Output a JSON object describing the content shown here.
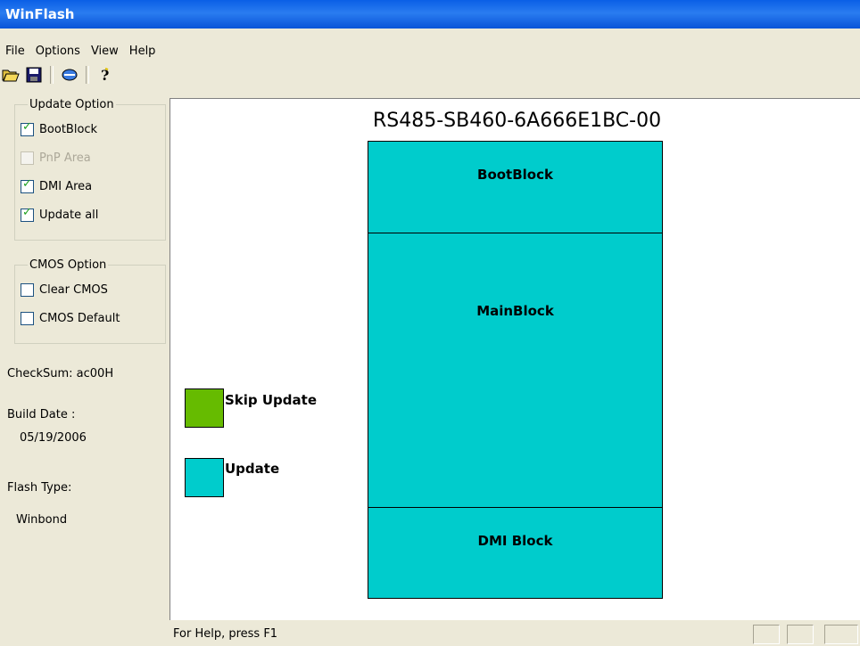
{
  "window": {
    "title": "WinFlash"
  },
  "menu": [
    "File",
    "Options",
    "View",
    "Help"
  ],
  "toolbar": {
    "icons": [
      "open-folder-icon",
      "save-icon",
      "flash-icon",
      "help-icon"
    ]
  },
  "update_option": {
    "legend": "Update Option",
    "items": [
      {
        "label": "BootBlock",
        "checked": true,
        "enabled": true
      },
      {
        "label": "PnP Area",
        "checked": false,
        "enabled": false
      },
      {
        "label": "DMI Area",
        "checked": true,
        "enabled": true
      },
      {
        "label": "Update all",
        "checked": true,
        "enabled": true
      }
    ]
  },
  "cmos_option": {
    "legend": "CMOS Option",
    "items": [
      {
        "label": "Clear CMOS",
        "checked": false,
        "enabled": true
      },
      {
        "label": "CMOS Default",
        "checked": false,
        "enabled": true
      }
    ]
  },
  "info": {
    "checksum_label": "CheckSum:",
    "checksum_value": "ac00H",
    "build_date_label": "Build Date :",
    "build_date_value": "05/19/2006",
    "flash_type_label": "Flash Type:",
    "flash_type_value": "Winbond"
  },
  "chip": {
    "title": "RS485-SB460-6A666E1BC-00",
    "blocks": [
      "BootBlock",
      "MainBlock",
      "DMI Block"
    ]
  },
  "legend": {
    "skip": {
      "label": "Skip Update",
      "color": "#66bb00"
    },
    "update": {
      "label": "Update",
      "color": "#00cccc"
    }
  },
  "status": {
    "text": "For Help, press F1"
  }
}
